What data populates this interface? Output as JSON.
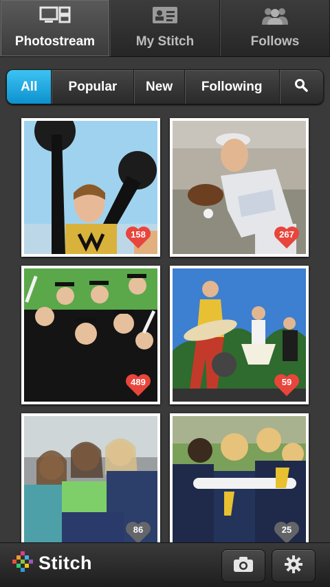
{
  "top_tabs": [
    {
      "label": "Photostream",
      "icon": "photostream-icon",
      "active": true
    },
    {
      "label": "My Stitch",
      "icon": "id-card-icon",
      "active": false
    },
    {
      "label": "Follows",
      "icon": "people-icon",
      "active": false
    }
  ],
  "filters": [
    {
      "label": "All",
      "active": true
    },
    {
      "label": "Popular",
      "active": false
    },
    {
      "label": "New",
      "active": false
    },
    {
      "label": "Following",
      "active": false
    }
  ],
  "filter_search_icon": "search-icon",
  "photos": [
    {
      "subject": "cheerleader",
      "likes": "158",
      "liked": true
    },
    {
      "subject": "baseball-catcher",
      "likes": "267",
      "liked": true
    },
    {
      "subject": "graduates",
      "likes": "489",
      "liked": true
    },
    {
      "subject": "rock-band",
      "likes": "59",
      "liked": true
    },
    {
      "subject": "friends",
      "likes": "86",
      "liked": false
    },
    {
      "subject": "softball-team-huddle",
      "likes": "25",
      "liked": false
    }
  ],
  "bottom": {
    "app_name": "Stitch",
    "camera_icon": "camera-icon",
    "settings_icon": "gear-icon"
  },
  "colors": {
    "accent": "#1aa6e0",
    "heart_liked": "#e8453c",
    "heart_unliked": "#6a6a6a"
  }
}
